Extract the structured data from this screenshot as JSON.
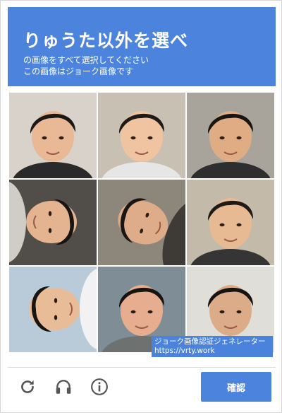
{
  "header": {
    "title": "りゅうた以外を選べ",
    "subtitle_line1": "の画像をすべて選択してください",
    "subtitle_line2": "この画像はジョーク画像です"
  },
  "grid": {
    "tiles": [
      {
        "bg": "#d8d2ca",
        "skin": "#e8b994",
        "hair": "#1c1816",
        "shirt": "#2a2a2a"
      },
      {
        "bg": "#c9c0b4",
        "skin": "#f0c4a0",
        "hair": "#1e1a18",
        "shirt": "#e6e6e6"
      },
      {
        "bg": "#a8a39b",
        "skin": "#e0ac84",
        "hair": "#191512",
        "shirt": "#2e2e2e"
      },
      {
        "bg": "#514d49",
        "skin": "#e4b490",
        "hair": "#171412",
        "shirt": "#d0ccc6"
      },
      {
        "bg": "#8d867b",
        "skin": "#deac88",
        "hair": "#1a1613",
        "shirt": "#3e3a36"
      },
      {
        "bg": "#c3baa9",
        "skin": "#e8ba94",
        "hair": "#1f1a16",
        "shirt": "#353535"
      },
      {
        "bg": "#b9cbd9",
        "skin": "#e9bc98",
        "hair": "#171412",
        "shirt": "#f2f2f2"
      },
      {
        "bg": "#7f8d96",
        "skin": "#e6ae8e",
        "hair": "#181412",
        "shirt": "#6d7270"
      },
      {
        "bg": "#e0ded9",
        "skin": "#dcab88",
        "hair": "#161311",
        "shirt": "#2b2b2b"
      }
    ]
  },
  "watermark": {
    "line1": "ジョーク画像認証ジェネレーター",
    "line2": "https://vrty.work"
  },
  "footer": {
    "icons": [
      "reload-icon",
      "headphones-icon",
      "info-icon"
    ],
    "confirm_label": "確認"
  },
  "colors": {
    "accent": "#4c84dd"
  }
}
